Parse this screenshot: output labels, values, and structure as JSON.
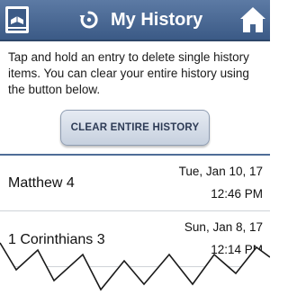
{
  "header": {
    "title": "My History",
    "bible_icon": "bible-book-icon",
    "history_icon": "history-refresh-icon",
    "home_icon": "home-icon"
  },
  "instructions": "Tap and hold an entry to delete single history items. You can clear your entire history using the button below.",
  "clear_button_label": "CLEAR ENTIRE HISTORY",
  "entries": [
    {
      "passage": "Matthew 4",
      "date": "Tue, Jan 10, 17",
      "time": "12:46 PM"
    },
    {
      "passage": "1 Corinthians 3",
      "date": "Sun, Jan 8, 17",
      "time": "12:14 PM"
    }
  ],
  "colors": {
    "header": "#4a6a96",
    "accent_line": "#4f6d97",
    "button_text": "#2d3b55"
  }
}
